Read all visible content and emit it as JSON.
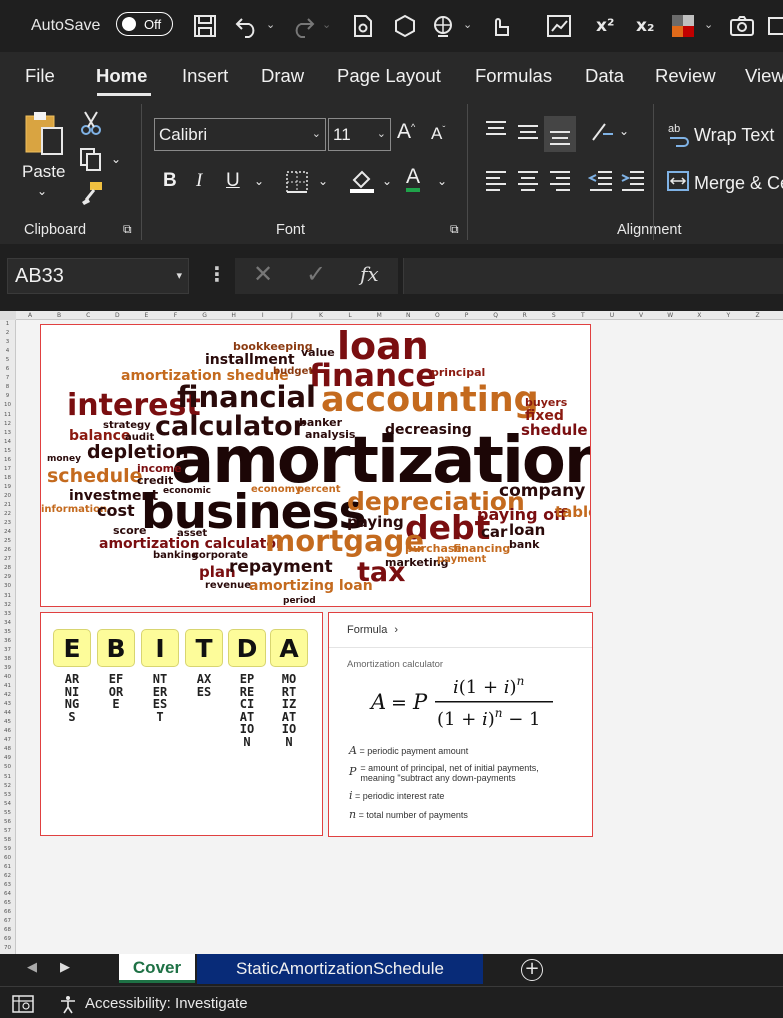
{
  "titlebar": {
    "autosave_label": "AutoSave",
    "autosave_state": "Off",
    "superscript_label": "x²",
    "subscript_label": "x₂"
  },
  "menu": {
    "tabs": [
      "File",
      "Home",
      "Insert",
      "Draw",
      "Page Layout",
      "Formulas",
      "Data",
      "Review",
      "View"
    ]
  },
  "ribbon": {
    "clipboard": {
      "label": "Clipboard",
      "paste_label": "Paste"
    },
    "font": {
      "label": "Font",
      "name": "Calibri",
      "size": "11",
      "bold": "B",
      "italic": "I",
      "underline": "U",
      "grow": "A",
      "shrink": "A",
      "color_letter": "A"
    },
    "alignment": {
      "label": "Alignment",
      "wrap_text": "Wrap Text",
      "merge": "Merge & Ce"
    }
  },
  "formula_bar": {
    "name_box": "AB33",
    "fx": "fx",
    "value": ""
  },
  "grid": {
    "columns": [
      "A",
      "B",
      "C",
      "D",
      "E",
      "F",
      "G",
      "H",
      "I",
      "J",
      "K",
      "L",
      "M",
      "N",
      "O",
      "P",
      "Q",
      "R",
      "S",
      "T",
      "U",
      "V",
      "W",
      "X",
      "Y",
      "Z"
    ],
    "rows": [
      "1",
      "2",
      "3",
      "4",
      "5",
      "6",
      "7",
      "8",
      "9",
      "10",
      "11",
      "12",
      "13",
      "14",
      "15",
      "16",
      "17",
      "18",
      "19",
      "20",
      "21",
      "22",
      "23",
      "24",
      "25",
      "26",
      "27",
      "28",
      "29",
      "30",
      "31",
      "32",
      "33",
      "34",
      "35",
      "36",
      "37",
      "38",
      "39",
      "40",
      "41",
      "42",
      "43",
      "44",
      "45",
      "46",
      "47",
      "48",
      "49",
      "50",
      "51",
      "52",
      "53",
      "54",
      "55",
      "56",
      "57",
      "58",
      "59",
      "60",
      "61",
      "62",
      "63",
      "64",
      "65",
      "66",
      "67",
      "68",
      "69",
      "70"
    ]
  },
  "wordcloud": {
    "words": {
      "loan": "loan",
      "bookkeeping": "bookkeeping",
      "installment": "installment",
      "value": "value",
      "finance": "finance",
      "amortization_shedule": "amortization shedule",
      "budget": "budget",
      "principal": "principal",
      "interest": "interest",
      "financial": "financial",
      "accounting": "accounting",
      "buyers": "buyers",
      "fixed": "fixed",
      "strategy": "strategy",
      "calculator": "calculator",
      "banker": "banker",
      "decreasing": "decreasing",
      "shedule": "shedule",
      "balance": "balance",
      "audit": "audit",
      "analysis": "analysis",
      "depletion": "depletion",
      "money": "money",
      "amortization": "amortization",
      "schedule": "schedule",
      "income": "income",
      "credit": "credit",
      "investment": "investment",
      "economic": "economic",
      "economy": "economy",
      "percent": "percent",
      "company": "company",
      "information": "information",
      "cost": "cost",
      "business": "business",
      "depreciation": "depreciation",
      "paying": "paying",
      "debt": "debt",
      "paying_off": "paying off",
      "table": "table",
      "score": "score",
      "asset": "asset",
      "car": "car",
      "loan2": "loan",
      "bank": "bank",
      "amortization_calculator": "amortization calculator",
      "mortgage": "mortgage",
      "purchase": "purchase",
      "financing": "financing",
      "banking": "banking",
      "corporate": "corporate",
      "marketing": "marketing",
      "payment": "payment",
      "plan": "plan",
      "repayment": "repayment",
      "tax": "tax",
      "revenue": "revenue",
      "amortizing_loan": "amortizing loan",
      "period": "period"
    }
  },
  "ebitda": {
    "letters": [
      "E",
      "B",
      "I",
      "T",
      "D",
      "A"
    ],
    "words": [
      "ARNINGS",
      "EFORE",
      "NTEREST",
      "AXES",
      "EPRECIATION",
      "MORTIZATION"
    ]
  },
  "formula_card": {
    "header": "Formula",
    "subtitle": "Amortization calculator",
    "legend": [
      {
        "symbol": "A",
        "text": "= periodic payment amount"
      },
      {
        "symbol": "P",
        "text": "= amount of principal, net of initial payments, meaning \"subtract any down-payments"
      },
      {
        "symbol": "i",
        "text": "= periodic interest rate"
      },
      {
        "symbol": "n",
        "text": "= total number of payments"
      }
    ]
  },
  "sheet_tabs": {
    "tabs": [
      "Cover",
      "StaticAmortizationSchedule"
    ],
    "active": "Cover"
  },
  "status": {
    "accessibility": "Accessibility: Investigate"
  },
  "colors": {
    "accent_green": "#1e7145",
    "tab_blue": "#082b78",
    "frame_red": "#e04040"
  }
}
